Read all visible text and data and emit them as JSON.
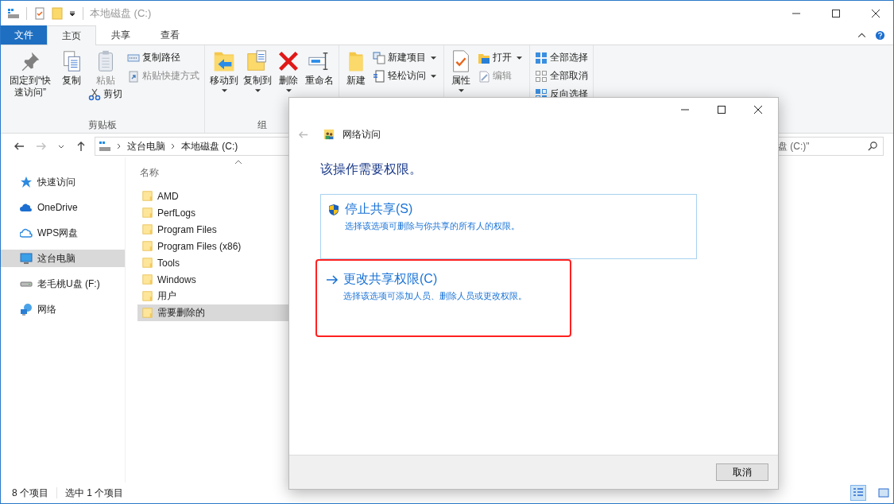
{
  "window": {
    "title": "本地磁盘 (C:)"
  },
  "ribbon_tabs": [
    {
      "label": "文件",
      "kind": "file",
      "selected": false
    },
    {
      "label": "主页",
      "kind": "tab",
      "selected": true
    },
    {
      "label": "共享",
      "kind": "tab",
      "selected": false
    },
    {
      "label": "查看",
      "kind": "tab",
      "selected": false
    }
  ],
  "ribbon": {
    "groups": [
      {
        "label": "剪贴板",
        "items": [
          {
            "label": "固定到“快速访问”",
            "kind": "large",
            "caret": false,
            "disabled": false
          },
          {
            "label": "复制",
            "kind": "large",
            "caret": false,
            "disabled": false
          },
          {
            "label": "粘贴",
            "kind": "medium",
            "caret": false,
            "disabled": true
          },
          {
            "label": "剪切",
            "kind": "small",
            "caret": false,
            "disabled": false
          },
          {
            "label": "复制路径",
            "kind": "small",
            "caret": false,
            "disabled": false
          },
          {
            "label": "粘贴快捷方式",
            "kind": "small",
            "caret": false,
            "disabled": true
          }
        ]
      },
      {
        "label": "组",
        "items": [
          {
            "label": "移动到",
            "kind": "large",
            "caret": true,
            "disabled": false
          },
          {
            "label": "复制到",
            "kind": "large",
            "caret": true,
            "disabled": false
          },
          {
            "label": "删除",
            "kind": "large",
            "caret": true,
            "disabled": false
          },
          {
            "label": "重命名",
            "kind": "large",
            "caret": false,
            "disabled": false
          }
        ]
      },
      {
        "items": [
          {
            "label": "新建",
            "kind": "large",
            "caret": false,
            "disabled": false
          },
          {
            "label": "新建项目",
            "kind": "small",
            "caret": true,
            "disabled": false
          },
          {
            "label": "轻松访问",
            "kind": "small",
            "caret": true,
            "disabled": false
          }
        ]
      },
      {
        "items": [
          {
            "label": "属性",
            "kind": "large",
            "caret": true,
            "disabled": false
          },
          {
            "label": "打开",
            "kind": "small",
            "caret": true,
            "disabled": false
          },
          {
            "label": "编辑",
            "kind": "small",
            "caret": false,
            "disabled": true
          }
        ]
      },
      {
        "items": [
          {
            "label": "全部选择",
            "kind": "small",
            "caret": false,
            "disabled": false
          },
          {
            "label": "全部取消",
            "kind": "small",
            "caret": false,
            "disabled": false
          },
          {
            "label": "反向选择",
            "kind": "small",
            "caret": false,
            "disabled": false
          }
        ]
      }
    ]
  },
  "address": {
    "forward_disabled": true,
    "path": [
      "这台电脑",
      "本地磁盘 (C:)"
    ],
    "search_placeholder": "盘 (C:)\""
  },
  "navigation": [
    {
      "label": "快速访问",
      "selected": false
    },
    {
      "label": "OneDrive",
      "selected": false
    },
    {
      "label": "WPS网盘",
      "selected": false
    },
    {
      "label": "这台电脑",
      "selected": true
    },
    {
      "label": "老毛桃U盘 (F:)",
      "selected": false
    },
    {
      "label": "网络",
      "selected": false
    }
  ],
  "files": {
    "column": "名称",
    "rows": [
      {
        "name": "AMD",
        "selected": false
      },
      {
        "name": "PerfLogs",
        "selected": false
      },
      {
        "name": "Program Files",
        "selected": false
      },
      {
        "name": "Program Files (x86)",
        "selected": false
      },
      {
        "name": "Tools",
        "selected": false
      },
      {
        "name": "Windows",
        "selected": false
      },
      {
        "name": "用户",
        "selected": false
      },
      {
        "name": "需要删除的",
        "selected": true
      }
    ]
  },
  "status_bar": {
    "count": "8 个项目",
    "selection": "选中 1 个项目",
    "view_details_selected": true
  },
  "dialog": {
    "title": "网络访问",
    "heading": "该操作需要权限。",
    "options": [
      {
        "title": "停止共享(S)",
        "description": "选择该选项可删除与你共享的所有人的权限。",
        "selected": true,
        "highlighted": false
      },
      {
        "title": "更改共享权限(C)",
        "description": "选择该选项可添加人员、删除人员或更改权限。",
        "selected": false,
        "highlighted": true
      }
    ],
    "buttons": [
      "取消"
    ]
  }
}
